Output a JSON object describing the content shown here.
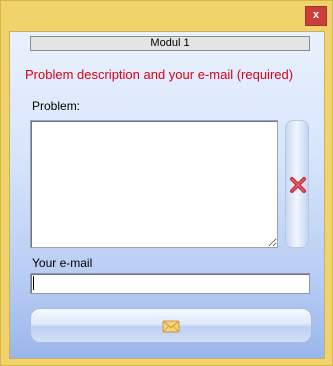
{
  "window": {
    "close_glyph": "x",
    "module_title": "Modul 1",
    "required_note": "Problem description and your e-mail (required)"
  },
  "form": {
    "problem_label": "Problem:",
    "problem_value": "",
    "email_label": "Your e-mail",
    "email_value": ""
  },
  "icons": {
    "clear": "red-x-icon",
    "send": "envelope-icon"
  },
  "colors": {
    "title_bar": "#f0d36b",
    "close_button": "#c9403a",
    "required_text": "#d8001c"
  }
}
